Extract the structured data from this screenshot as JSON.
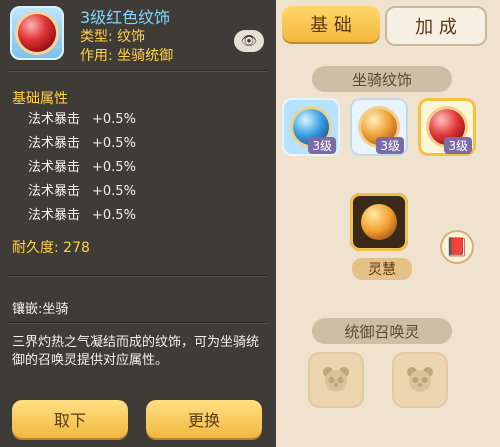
{
  "item": {
    "title": "3级红色纹饰",
    "type_line": "类型: 纹饰",
    "use_line": "作用: 坐骑统御"
  },
  "left": {
    "basic_attr_title": "基础属性",
    "attributes": [
      {
        "name": "法术暴击",
        "value": "+0.5%"
      },
      {
        "name": "法术暴击",
        "value": "+0.5%"
      },
      {
        "name": "法术暴击",
        "value": "+0.5%"
      },
      {
        "name": "法术暴击",
        "value": "+0.5%"
      },
      {
        "name": "法术暴击",
        "value": "+0.5%"
      }
    ],
    "durability": "耐久度: 278",
    "inlay": "镶嵌:坐骑",
    "description": "三界灼热之气凝结而成的纹饰，可为坐骑统御的召唤灵提供对应属性。",
    "buttons": {
      "remove": "取下",
      "replace": "更换"
    }
  },
  "right": {
    "tabs": {
      "basic": "基 础",
      "bonus": "加 成"
    },
    "section_mount_decor": "坐骑纹饰",
    "slots": [
      {
        "color": "blue",
        "level": "3级"
      },
      {
        "color": "gold",
        "level": "3级"
      },
      {
        "color": "red",
        "level": "3级"
      }
    ],
    "center_label": "灵慧",
    "section_command": "统御召唤灵"
  },
  "icons": {
    "eye": "eye-icon",
    "book": "book-icon",
    "panda": "panda-icon"
  },
  "colors": {
    "accent_yellow": "#ffd24a",
    "title_blue": "#7fd7ff",
    "panel_bg": "#3f3b37",
    "right_bg": "#efe3cf"
  }
}
